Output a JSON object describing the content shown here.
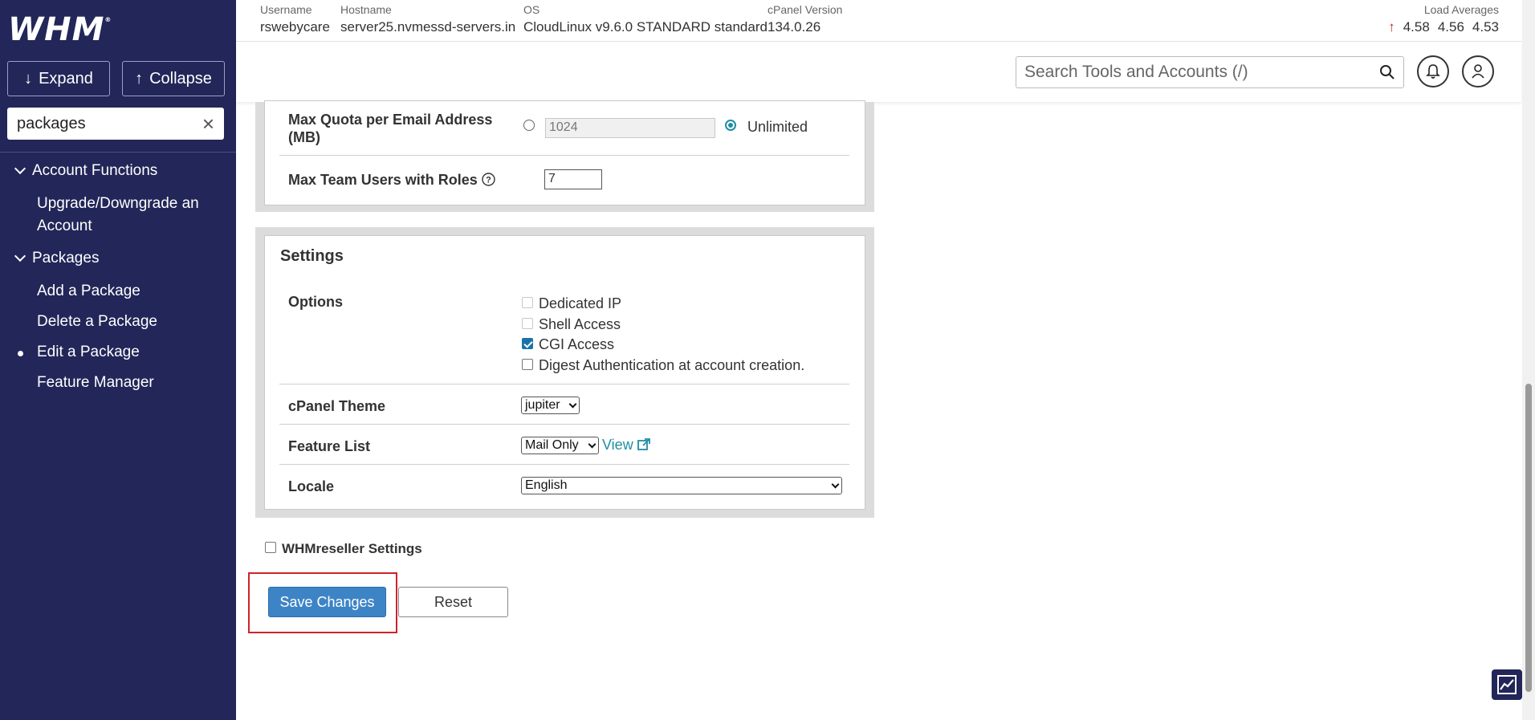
{
  "sidebar": {
    "logo": "WHM",
    "logo_mark": "®",
    "expand_label": "Expand",
    "collapse_label": "Collapse",
    "search_value": "packages",
    "categories": [
      {
        "label": "Account Functions",
        "items": [
          "Upgrade/Downgrade an Account"
        ]
      },
      {
        "label": "Packages",
        "items": [
          "Add a Package",
          "Delete a Package",
          "Edit a Package",
          "Feature Manager"
        ]
      }
    ],
    "active_item": "Edit a Package",
    "bg_color": "#222658"
  },
  "header": {
    "username_label": "Username",
    "username": "rswebycare",
    "hostname_label": "Hostname",
    "hostname": "server25.nvmessd-servers.in",
    "os_label": "OS",
    "os": "CloudLinux v9.6.0 STANDARD standard",
    "cpanel_label": "cPanel Version",
    "cpanel_version": "134.0.26",
    "load_label": "Load Averages",
    "load": [
      "4.58",
      "4.56",
      "4.53"
    ],
    "search_placeholder": "Search Tools and Accounts (/)"
  },
  "quota": {
    "max_quota_label": "Max Quota per Email Address (MB)",
    "max_quota_value": "1024",
    "unlimited_label": "Unlimited",
    "team_users_label": "Max Team Users with Roles",
    "team_users_value": "7"
  },
  "settings": {
    "title": "Settings",
    "options_label": "Options",
    "options": [
      {
        "label": "Dedicated IP",
        "checked": false,
        "disabled": true
      },
      {
        "label": "Shell Access",
        "checked": false,
        "disabled": true
      },
      {
        "label": "CGI Access",
        "checked": true,
        "disabled": false
      },
      {
        "label": "Digest Authentication at account creation.",
        "checked": false,
        "disabled": false
      }
    ],
    "theme_label": "cPanel Theme",
    "theme_value": "jupiter",
    "feature_list_label": "Feature List",
    "feature_list_value": "Mail Only",
    "view_link": "View",
    "locale_label": "Locale",
    "locale_value": "English"
  },
  "reseller": {
    "label": "WHMreseller Settings"
  },
  "actions": {
    "save_label": "Save Changes",
    "reset_label": "Reset"
  },
  "colors": {
    "accent": "#1e8ea5",
    "primary_button": "#3d84c6",
    "highlight": "#d0232a"
  }
}
